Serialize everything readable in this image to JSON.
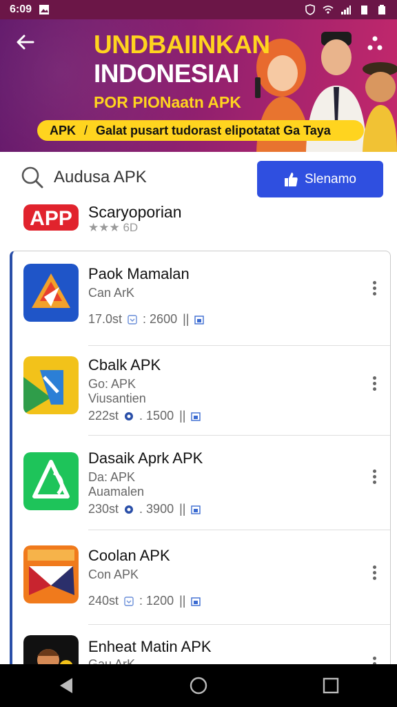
{
  "status_bar": {
    "time": "6:09"
  },
  "banner": {
    "title_line1": "UNDBAIINKAN",
    "title_line2": "INDONESIAI",
    "title_line3": "POR PIONaatn APK",
    "strip_left": "APK",
    "strip_right": "Galat pusart tudorast elipotatat Ga Taya"
  },
  "search": {
    "text": "Audusa APK"
  },
  "action_button": {
    "label": "Slenamo"
  },
  "featured_app": {
    "logo_text": "APP",
    "name": "Scaryoporian",
    "rating_extra": "6D"
  },
  "apps": [
    {
      "name": "Paok Mamalan",
      "subtitle": "Can ArK",
      "note": "",
      "size": "17.0st",
      "count": ": 2600"
    },
    {
      "name": "Cbalk APK",
      "subtitle": "Go: APK",
      "note": "Viusantien",
      "size": "222st",
      "count": ". 1500"
    },
    {
      "name": "Dasaik Aprk APK",
      "subtitle": "Da: APK",
      "note": "Auamalen",
      "size": "230st",
      "count": ". 3900"
    },
    {
      "name": "Coolan APK",
      "subtitle": "Con APK",
      "note": "",
      "size": "240st",
      "count": ": 1200"
    },
    {
      "name": "Enheat Matin APK",
      "subtitle": "Gau ArK",
      "note": "",
      "size": "",
      "count": ""
    }
  ],
  "colors": {
    "banner": "#7a1a6c",
    "accent_yellow": "#ffd41f",
    "button_blue": "#2f4fe0",
    "card_edge": "#2a4fa8"
  }
}
